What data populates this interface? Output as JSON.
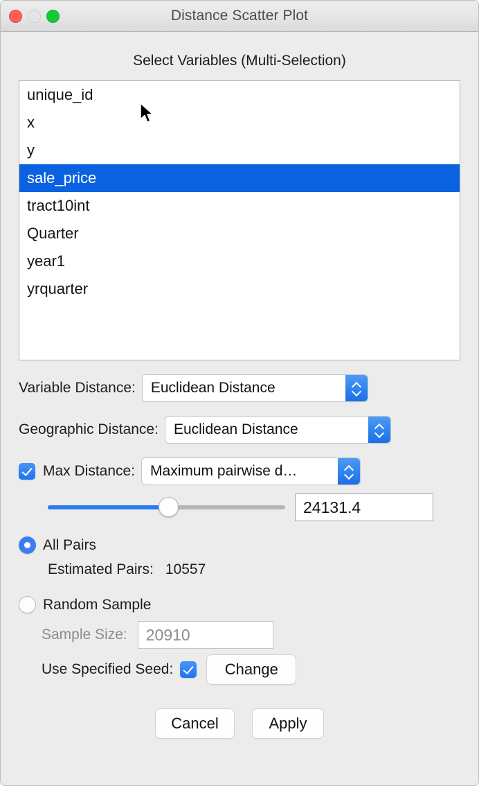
{
  "window": {
    "title": "Distance Scatter Plot",
    "traffic_lights": [
      "close-button",
      "minimize-button",
      "zoom-button"
    ]
  },
  "variables_section": {
    "heading": "Select Variables (Multi-Selection)",
    "items": [
      {
        "label": "unique_id",
        "selected": false
      },
      {
        "label": "x",
        "selected": false
      },
      {
        "label": "y",
        "selected": false
      },
      {
        "label": "sale_price",
        "selected": true
      },
      {
        "label": "tract10int",
        "selected": false
      },
      {
        "label": "Quarter",
        "selected": false
      },
      {
        "label": "year1",
        "selected": false
      },
      {
        "label": "yrquarter",
        "selected": false
      }
    ]
  },
  "variable_distance": {
    "label": "Variable Distance:",
    "value": "Euclidean Distance"
  },
  "geographic_distance": {
    "label": "Geographic Distance:",
    "value": "Euclidean Distance"
  },
  "max_distance": {
    "label": "Max Distance:",
    "checked": true,
    "method": "Maximum pairwise d…",
    "slider_percent": 51,
    "value": "24131.4"
  },
  "all_pairs": {
    "label": "All Pairs",
    "selected": true,
    "estimated_label": "Estimated Pairs:",
    "estimated_value": "10557"
  },
  "random_sample": {
    "label": "Random Sample",
    "selected": false,
    "sample_size_label": "Sample Size:",
    "sample_size_value": "20910",
    "seed_label": "Use Specified Seed:",
    "seed_checked": true,
    "change_button": "Change"
  },
  "footer": {
    "cancel": "Cancel",
    "apply": "Apply"
  },
  "colors": {
    "accent_blue": "#1f74ee",
    "selection_blue": "#0b62e0",
    "window_bg": "#ececec",
    "close_red": "#ff5f57",
    "zoom_green": "#14c938"
  }
}
